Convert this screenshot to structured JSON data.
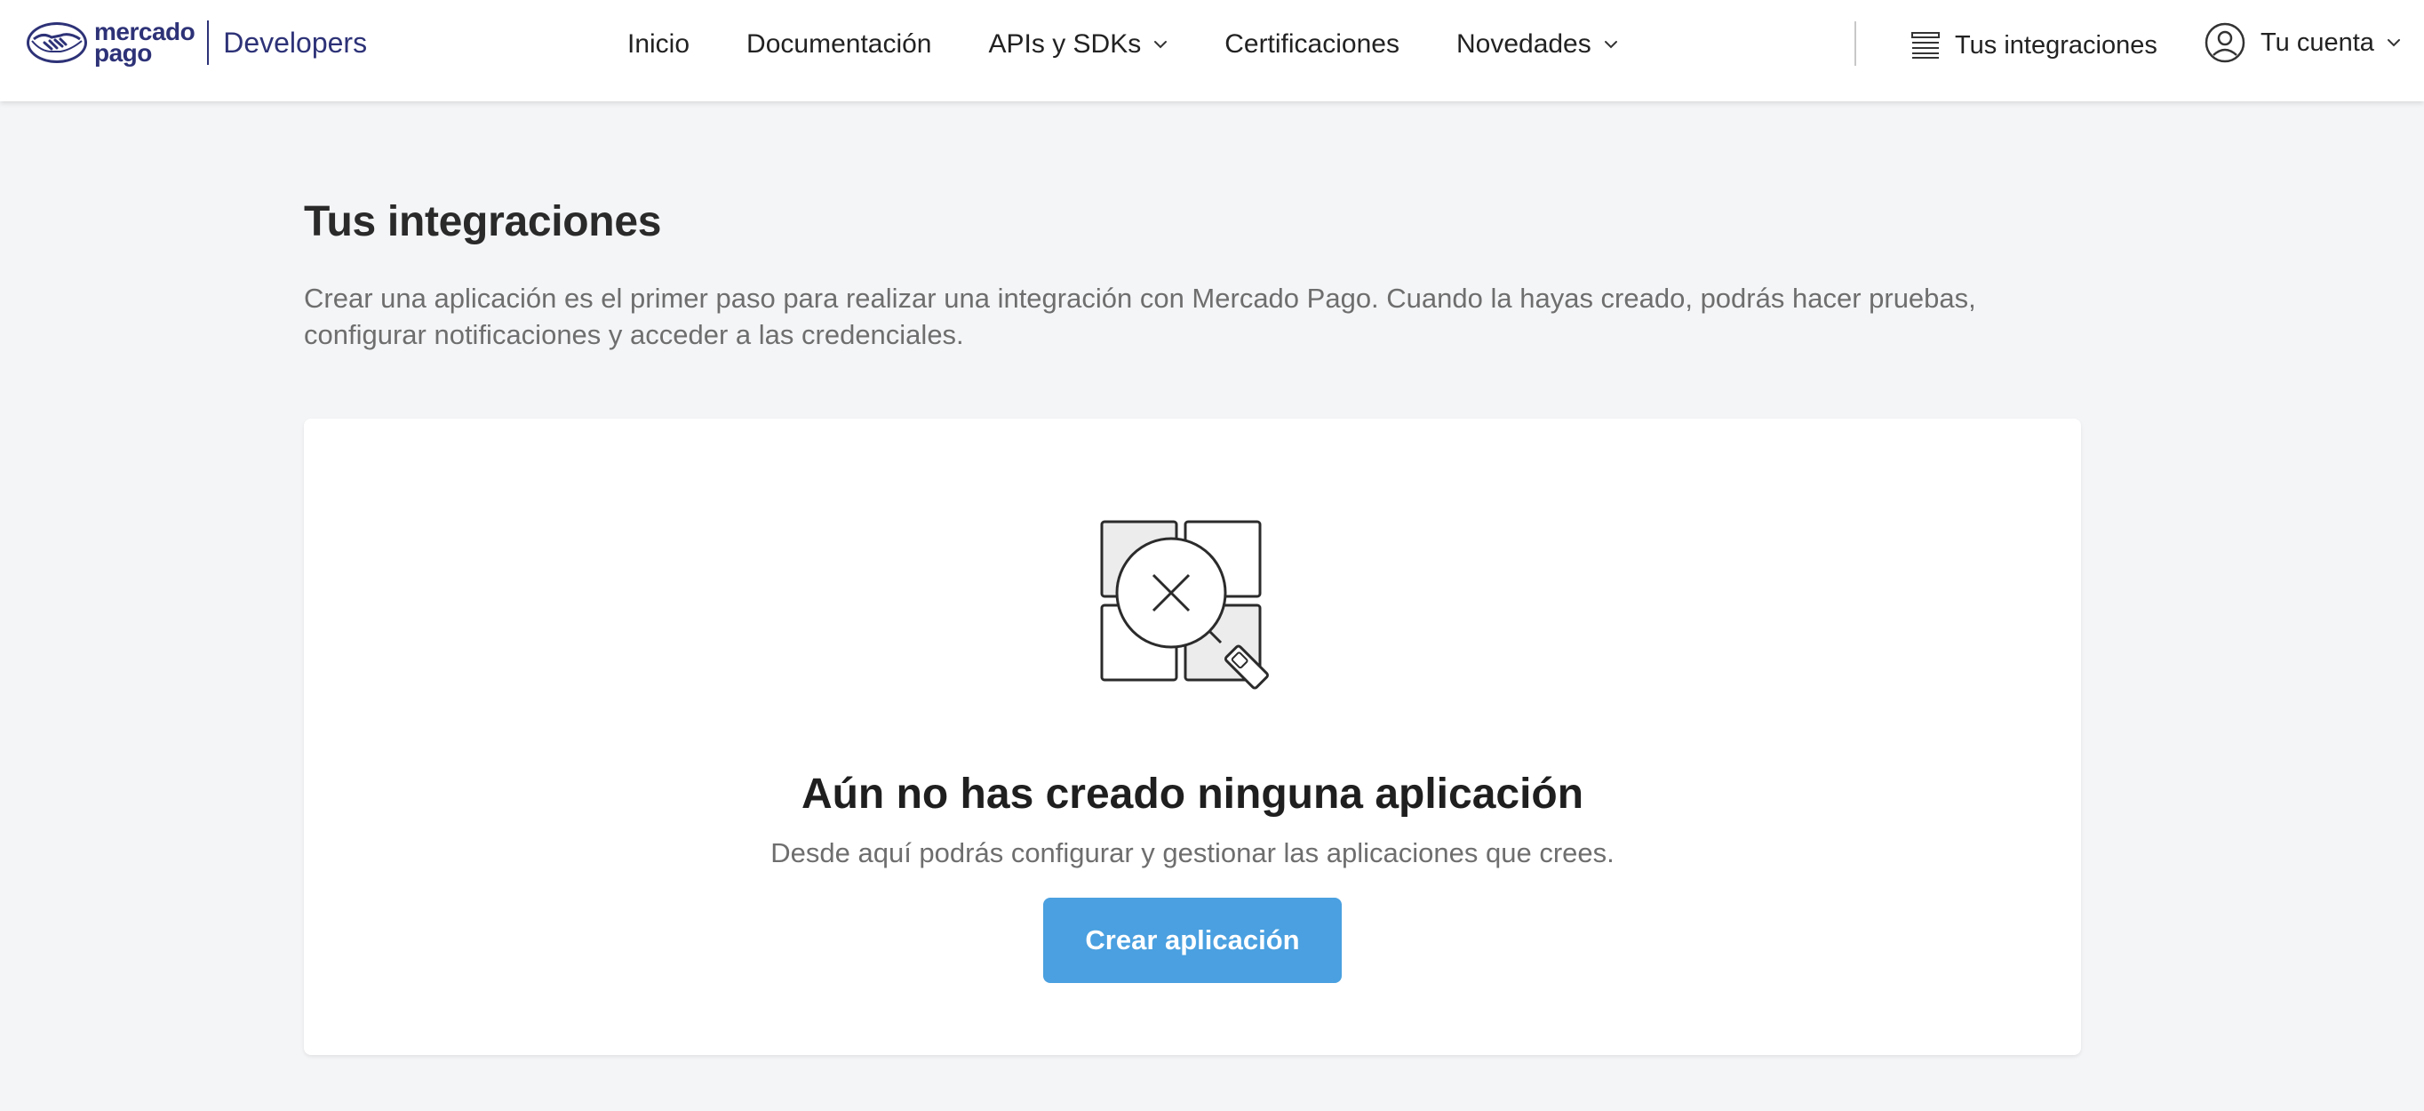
{
  "brand": {
    "logo_line1": "mercado",
    "logo_line2": "pago",
    "section": "Developers",
    "logo_icon": "handshake-icon",
    "color": "#2d3277"
  },
  "nav": {
    "items": [
      {
        "label": "Inicio",
        "dropdown": false
      },
      {
        "label": "Documentación",
        "dropdown": false
      },
      {
        "label": "APIs y SDKs",
        "dropdown": true
      },
      {
        "label": "Certificaciones",
        "dropdown": false
      },
      {
        "label": "Novedades",
        "dropdown": true
      }
    ]
  },
  "header_right": {
    "integrations_label": "Tus integraciones",
    "integrations_icon": "list-icon",
    "account_label": "Tu cuenta",
    "account_icon": "user-circle-icon"
  },
  "main": {
    "title": "Tus integraciones",
    "description": "Crear una aplicación es el primer paso para realizar una integración con Mercado Pago. Cuando la hayas creado, podrás hacer pruebas, configurar notificaciones y acceder a las credenciales."
  },
  "empty_state": {
    "icon": "search-not-found-icon",
    "title": "Aún no has creado ninguna aplicación",
    "subtitle": "Desde aquí podrás configurar y gestionar las aplicaciones que crees.",
    "button_label": "Crear aplicación"
  },
  "colors": {
    "primary_button": "#4aa0e0",
    "background": "#f4f5f7",
    "brand": "#2d3277"
  }
}
